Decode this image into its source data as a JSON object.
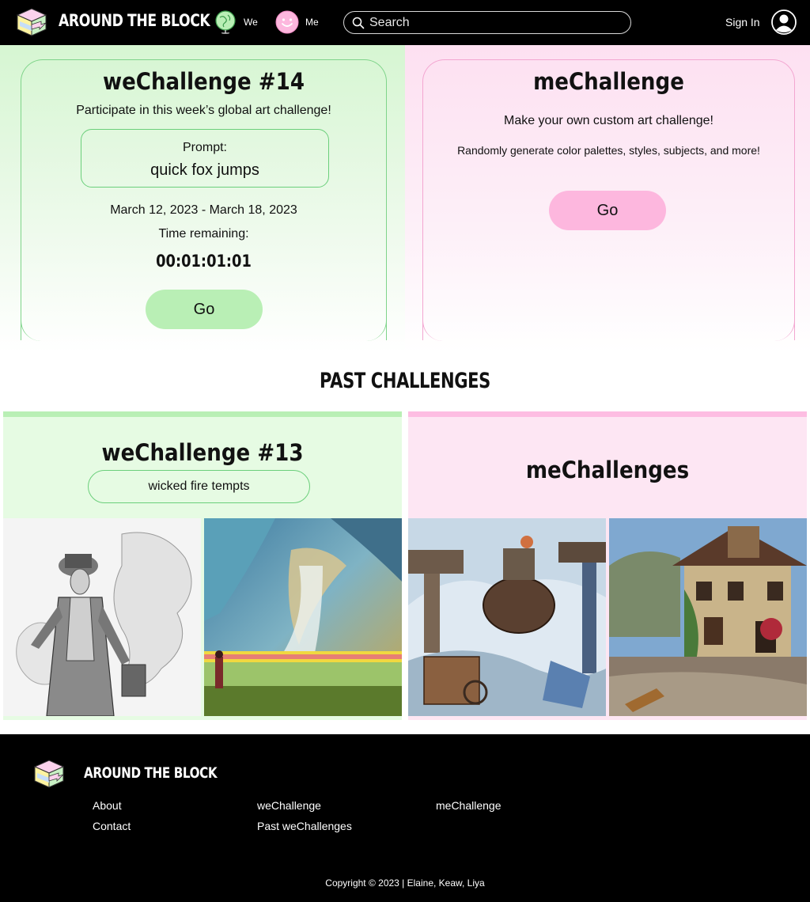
{
  "header": {
    "brand": "AROUND THE BLOCK",
    "nav": [
      {
        "label": "We",
        "icon": "globe-icon"
      },
      {
        "label": "Me",
        "icon": "smiley-icon"
      }
    ],
    "search": {
      "placeholder": "Search",
      "value": ""
    },
    "sign_in": "Sign In",
    "colors": {
      "background": "#000000",
      "text": "#ffffff"
    }
  },
  "hero": {
    "we": {
      "title": "weChallenge #14",
      "subtitle": "Participate in this week’s global art challenge!",
      "prompt_label": "Prompt:",
      "prompt_value": "quick fox jumps",
      "dates": "March 12, 2023 - March 18, 2023",
      "time_label": "Time remaining:",
      "timer": "00:01:01:01",
      "button": "Go",
      "accent": "#b9efb5"
    },
    "me": {
      "title": "meChallenge",
      "subtitle": "Make your own custom art challenge!",
      "description": "Randomly generate color palettes, styles, subjects, and more!",
      "button": "Go",
      "accent": "#fdb7de"
    }
  },
  "past": {
    "title": "PAST CHALLENGES",
    "we": {
      "title": "weChallenge #13",
      "prompt": "wicked fire tempts"
    },
    "me": {
      "title": "meChallenges"
    }
  },
  "footer": {
    "brand": "AROUND THE BLOCK",
    "links": {
      "about": "About",
      "contact": "Contact",
      "wechallenge": "weChallenge",
      "past_wechallenges": "Past weChallenges",
      "mechallenge": "meChallenge"
    },
    "copyright": "Copyright © 2023 | Elaine, Keaw, Liya"
  }
}
